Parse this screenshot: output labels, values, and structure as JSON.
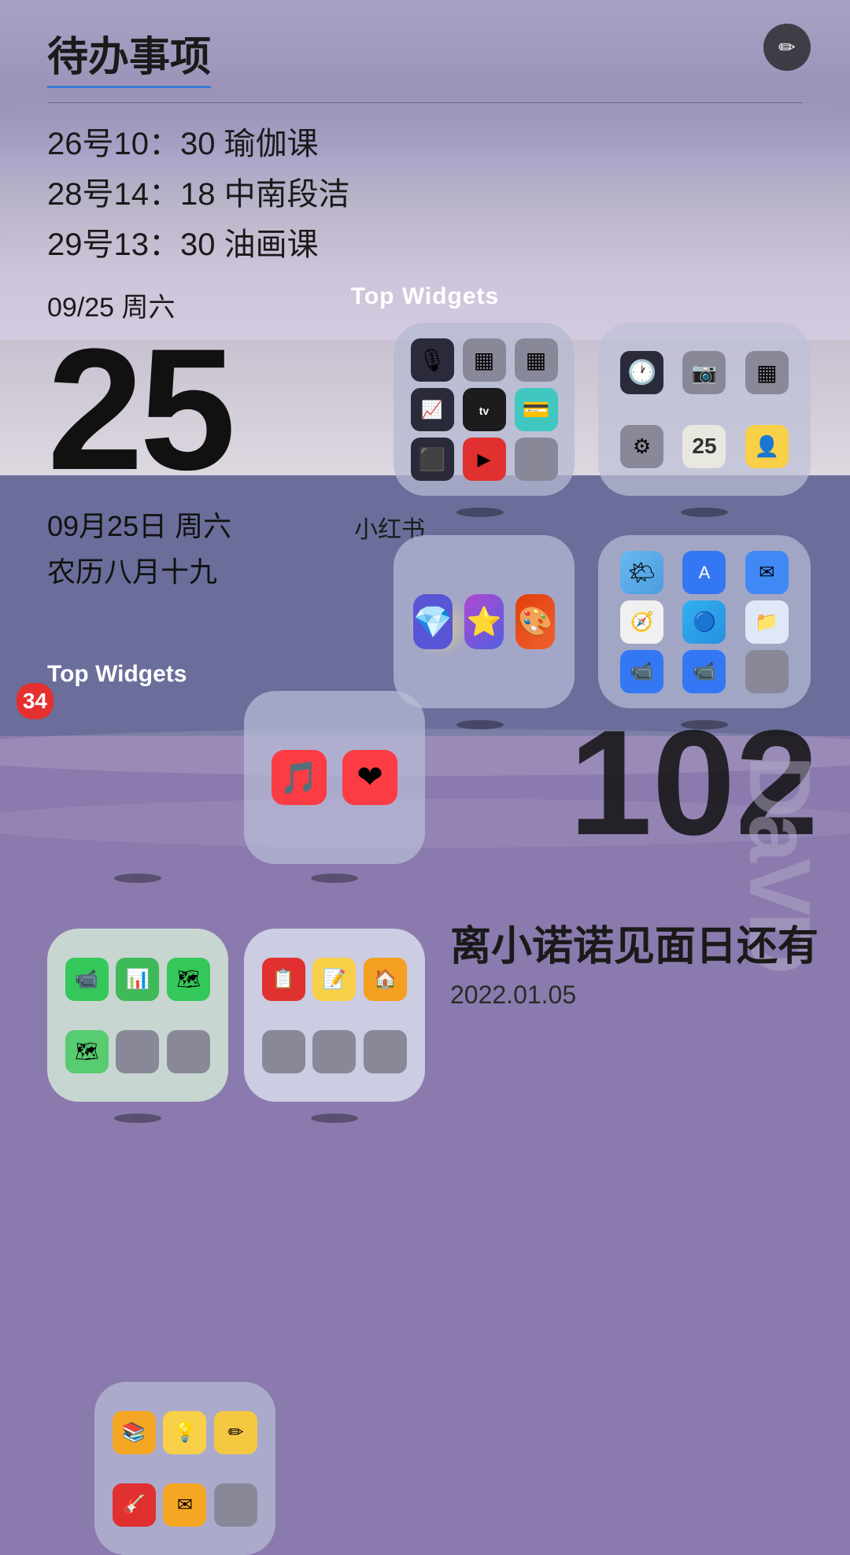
{
  "background": {
    "top_color": "#c4b0d8",
    "bottom_color": "#ddd8e0"
  },
  "todo_widget": {
    "title": "待办事项",
    "items": [
      "26号10：30 瑜伽课",
      "28号14：18 中南段洁",
      "29号13：30 油画课"
    ],
    "date": "09/25 周六",
    "edit_icon": "✏"
  },
  "top_widgets_label_1": "Top Widgets",
  "date_widget": {
    "big_number": "25",
    "detail_line1": "09月25日  周六",
    "detail_line2": "农历八月十九"
  },
  "widget_grid_1": {
    "icons": [
      "🎙",
      "⬛",
      "⬛",
      "📈",
      "📺",
      "💳",
      "⬛",
      "📹",
      "⬛"
    ]
  },
  "widget_grid_2": {
    "icons": [
      "🕐",
      "📷",
      "⬛",
      "⚙",
      "25",
      "👤"
    ]
  },
  "xiaohongshu_label": "小红书",
  "widget_grid_3": {
    "icons": [
      "💎",
      "⭐",
      "🎨"
    ]
  },
  "widget_grid_4": {
    "icons": [
      "🌤",
      "📦",
      "✉",
      "🧭",
      "🔵",
      "📁",
      "📹",
      "📹",
      "⬛"
    ]
  },
  "top_widgets_label_2": "Top Widgets",
  "number_102": "102",
  "widget_grid_5": {
    "badge": "34",
    "icons": [
      "📚",
      "💡",
      "✏",
      "🎸",
      "✉",
      "⬛"
    ]
  },
  "widget_grid_6": {
    "icons": [
      "🎵",
      "❤"
    ]
  },
  "watermark": "DaVD",
  "widget_bottom_1": {
    "icons": [
      "📹",
      "📊",
      "🗺",
      "🗺"
    ]
  },
  "widget_bottom_2": {
    "icons": [
      "📋",
      "🟡",
      "🏠",
      "⬛"
    ]
  },
  "countdown_widget": {
    "text": "离小诺诺见面日还有",
    "date": "2022.01.05"
  },
  "shadow_dots": true
}
